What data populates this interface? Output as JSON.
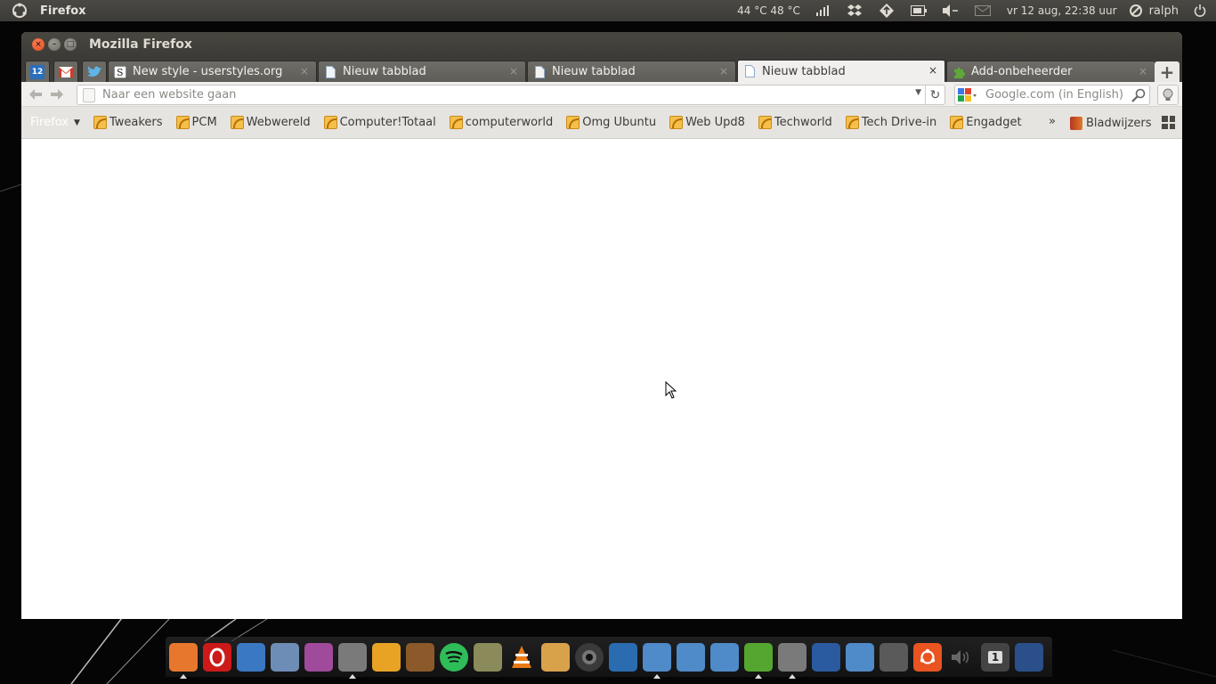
{
  "top_panel": {
    "app_name": "Firefox",
    "temperature": "44 °C 48 °C",
    "clock": "vr 12 aug, 22:38 uur",
    "user": "ralph",
    "indicators": [
      "signal-icon",
      "dropbox-icon",
      "network-icon",
      "battery-icon",
      "volume-icon",
      "mail-icon"
    ]
  },
  "window": {
    "title": "Mozilla Firefox"
  },
  "tabs": {
    "app_tabs": [
      {
        "icon": "calendar-icon",
        "text": "12"
      },
      {
        "icon": "gmail-icon"
      },
      {
        "icon": "twitter-icon"
      }
    ],
    "items": [
      {
        "label": "New style - userstyles.org",
        "icon": "userstyles-icon"
      },
      {
        "label": "Nieuw tabblad",
        "icon": "page-icon"
      },
      {
        "label": "Nieuw tabblad",
        "icon": "page-icon"
      },
      {
        "label": "Nieuw tabblad",
        "icon": "page-icon",
        "active": true
      },
      {
        "label": "Add-onbeheerder",
        "icon": "puzzle-icon"
      }
    ],
    "close_glyph": "×",
    "new_tab_glyph": "+"
  },
  "navbar": {
    "url_placeholder": "Naar een website gaan",
    "url_value": "",
    "search_placeholder": "Google.com (in English)"
  },
  "bookmarks": {
    "firefox_menu": "Firefox",
    "items": [
      "Tweakers",
      "PCM",
      "Webwereld",
      "Computer!Totaal",
      "computerworld",
      "Omg Ubuntu",
      "Web Upd8",
      "Techworld",
      "Tech Drive-in",
      "Engadget"
    ],
    "overflow": "»",
    "bookmarks_label": "Bladwijzers"
  },
  "dock": {
    "calendar_day": "1",
    "items": [
      {
        "name": "firefox-icon",
        "color": "#e8772e",
        "running": true
      },
      {
        "name": "opera-icon",
        "color": "#cc1a1a"
      },
      {
        "name": "search-tool-icon",
        "color": "#3b78c4"
      },
      {
        "name": "thunderbird-icon",
        "color": "#6d8db6"
      },
      {
        "name": "media-player-icon",
        "color": "#a04a9c"
      },
      {
        "name": "transfer-icon",
        "color": "#7a7a7a",
        "running": true
      },
      {
        "name": "bluefish-icon",
        "color": "#e8a325"
      },
      {
        "name": "speaker-icon",
        "color": "#8c5a2a"
      },
      {
        "name": "spotify-icon",
        "color": "#2ebd59"
      },
      {
        "name": "tv-icon",
        "color": "#8a8a5a"
      },
      {
        "name": "vlc-icon",
        "color": "#e27b17"
      },
      {
        "name": "paint-icon",
        "color": "#d8a24a"
      },
      {
        "name": "camera-icon",
        "color": "#3a3a3a"
      },
      {
        "name": "writer-icon",
        "color": "#2b6cb0"
      },
      {
        "name": "pictures-folder-icon",
        "color": "#4f8ac9",
        "running": true
      },
      {
        "name": "music-folder-icon",
        "color": "#4f8ac9"
      },
      {
        "name": "downloads-folder-icon",
        "color": "#4f8ac9"
      },
      {
        "name": "software-center-icon",
        "color": "#55a630",
        "running": true
      },
      {
        "name": "suit-icon",
        "color": "#7a7a7a",
        "running": true
      },
      {
        "name": "monitor-icon",
        "color": "#2a5aa0"
      },
      {
        "name": "home-folder-icon",
        "color": "#4f8ac9"
      },
      {
        "name": "usb-drive-icon",
        "color": "#5a5a5a"
      },
      {
        "name": "ubuntu-icon",
        "color": "#e95420"
      },
      {
        "name": "volume-dock-icon",
        "color": "#333333"
      },
      {
        "name": "workspace-icon",
        "color": "#444444"
      },
      {
        "name": "desktop-icon",
        "color": "#2a4f8a"
      }
    ]
  }
}
